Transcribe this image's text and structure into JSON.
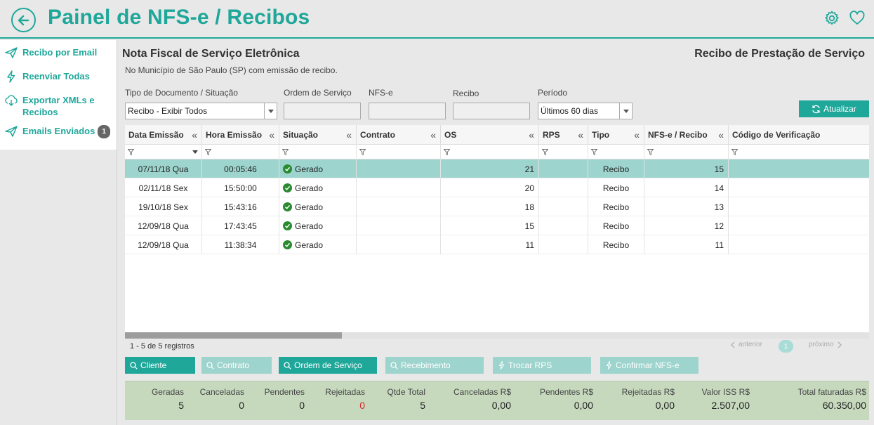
{
  "header": {
    "title": "Painel de NFS-e / Recibos",
    "icons": [
      "back-arrow-icon",
      "gear-icon",
      "heart-icon"
    ],
    "accent": "#1fa79a"
  },
  "sidebar": {
    "items": [
      {
        "label": "Recibo por Email",
        "icon": "paper-plane-icon"
      },
      {
        "label": "Reenviar Todas",
        "icon": "lightning-icon"
      },
      {
        "label": "Exportar XMLs e",
        "label2": "Recibos",
        "icon": "cloud-download-icon"
      },
      {
        "label": "Emails Enviados",
        "badge": "1",
        "icon": "paper-plane-icon"
      }
    ]
  },
  "main": {
    "title": "Nota Fiscal de Serviço Eletrônica",
    "subtitle": "No Município de São Paulo (SP) com emissão de recibo.",
    "right_title": "Recibo de Prestação de Serviço"
  },
  "filters": {
    "tipo_label": "Tipo de Documento / Situação",
    "tipo_value": "Recibo - Exibir Todos",
    "os_label": "Ordem de Serviço",
    "nfse_label": "NFS-e",
    "recibo_label": "Recibo",
    "periodo_label": "Período",
    "periodo_value": "Últimos 60 dias",
    "refresh_label": "Atualizar"
  },
  "grid": {
    "columns": [
      "Data Emissão",
      "Hora Emissão",
      "Situação",
      "Contrato",
      "OS",
      "RPS",
      "Tipo",
      "NFS-e / Recibo",
      "Código de Verificação"
    ],
    "rows": [
      {
        "data": "07/11/18 Qua",
        "hora": "00:05:46",
        "situacao": "Gerado",
        "contrato": "",
        "os": "21",
        "rps": "",
        "tipo": "Recibo",
        "nfse": "15",
        "codigo": "",
        "selected": true
      },
      {
        "data": "02/11/18 Sex",
        "hora": "15:50:00",
        "situacao": "Gerado",
        "contrato": "",
        "os": "20",
        "rps": "",
        "tipo": "Recibo",
        "nfse": "14",
        "codigo": ""
      },
      {
        "data": "19/10/18 Sex",
        "hora": "15:43:16",
        "situacao": "Gerado",
        "contrato": "",
        "os": "18",
        "rps": "",
        "tipo": "Recibo",
        "nfse": "13",
        "codigo": ""
      },
      {
        "data": "12/09/18 Qua",
        "hora": "17:43:45",
        "situacao": "Gerado",
        "contrato": "",
        "os": "15",
        "rps": "",
        "tipo": "Recibo",
        "nfse": "12",
        "codigo": ""
      },
      {
        "data": "12/09/18 Qua",
        "hora": "11:38:34",
        "situacao": "Gerado",
        "contrato": "",
        "os": "11",
        "rps": "",
        "tipo": "Recibo",
        "nfse": "11",
        "codigo": ""
      }
    ]
  },
  "footer": {
    "registros": "1 - 5 de 5 registros",
    "anterior": "anterior",
    "page": "1",
    "proximo": "próximo"
  },
  "actions": [
    {
      "label": "Cliente",
      "active": true
    },
    {
      "label": "Contrato",
      "active": false
    },
    {
      "label": "Ordem de Serviço",
      "active": true
    },
    {
      "label": "Recebimento",
      "active": false
    },
    {
      "label": "Trocar RPS",
      "active": false
    },
    {
      "label": "Confirmar NFS-e",
      "active": false
    }
  ],
  "totals": {
    "geradas_label": "Geradas",
    "geradas": "5",
    "canceladas_label": "Canceladas",
    "canceladas": "0",
    "pendentes_label": "Pendentes",
    "pendentes": "0",
    "rejeitadas_label": "Rejeitadas",
    "rejeitadas": "0",
    "qtde_label": "Qtde Total",
    "qtde": "5",
    "canc_rs_label": "Canceladas R$",
    "canc_rs": "0,00",
    "pend_rs_label": "Pendentes R$",
    "pend_rs": "0,00",
    "rej_rs_label": "Rejeitadas R$",
    "rej_rs": "0,00",
    "iss_label": "Valor ISS R$",
    "iss": "2.507,00",
    "total_label": "Total faturadas R$",
    "total": "60.350,00"
  }
}
